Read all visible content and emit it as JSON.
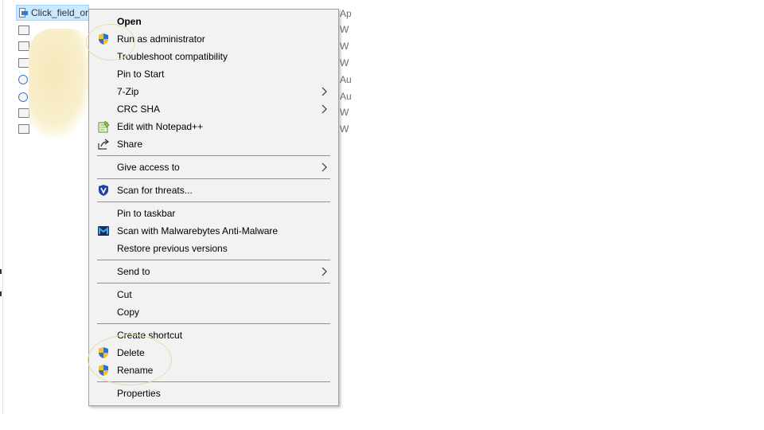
{
  "file_list": {
    "selected_file": "Click_field_or",
    "type_column": [
      "Ap",
      "W",
      "W",
      "W",
      "Au",
      "Au",
      "W",
      "W"
    ]
  },
  "context_menu": {
    "items": [
      {
        "label": "Open",
        "bold": true,
        "icon": null,
        "submenu": false
      },
      {
        "label": "Run as administrator",
        "icon": "uac-shield-icon",
        "submenu": false
      },
      {
        "label": "Troubleshoot compatibility",
        "icon": null,
        "submenu": false
      },
      {
        "label": "Pin to Start",
        "icon": null,
        "submenu": false
      },
      {
        "label": "7-Zip",
        "icon": null,
        "submenu": true
      },
      {
        "label": "CRC SHA",
        "icon": null,
        "submenu": true
      },
      {
        "label": "Edit with Notepad++",
        "icon": "notepad-plus-plus-icon",
        "submenu": false
      },
      {
        "label": "Share",
        "icon": "share-icon",
        "submenu": false
      },
      {
        "label": "Give access to",
        "icon": null,
        "submenu": true
      },
      {
        "label": "Scan for threats...",
        "icon": "antivirus-shield-icon",
        "submenu": false
      },
      {
        "label": "Pin to taskbar",
        "icon": null,
        "submenu": false
      },
      {
        "label": "Scan with Malwarebytes Anti-Malware",
        "icon": "malwarebytes-icon",
        "submenu": false
      },
      {
        "label": "Restore previous versions",
        "icon": null,
        "submenu": false
      },
      {
        "label": "Send to",
        "icon": null,
        "submenu": true
      },
      {
        "label": "Cut",
        "icon": null,
        "submenu": false
      },
      {
        "label": "Copy",
        "icon": null,
        "submenu": false
      },
      {
        "label": "Create shortcut",
        "icon": null,
        "submenu": false
      },
      {
        "label": "Delete",
        "icon": "uac-shield-icon",
        "submenu": false
      },
      {
        "label": "Rename",
        "icon": "uac-shield-icon",
        "submenu": false
      },
      {
        "label": "Properties",
        "icon": null,
        "submenu": false
      }
    ]
  },
  "colors": {
    "menu_background": "#f2f2f2",
    "menu_border": "#a0a0a0",
    "selection_highlight": "#cce8ff",
    "annotation_highlight": "#f5e7b8"
  }
}
